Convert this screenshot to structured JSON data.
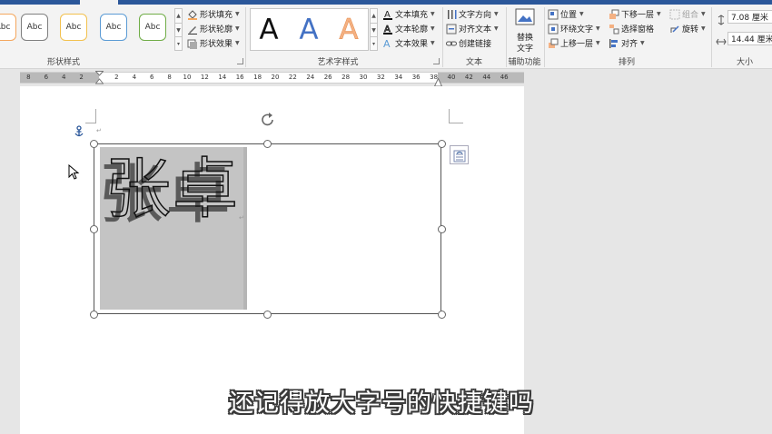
{
  "ribbon": {
    "shape_styles": {
      "label": "形状样式",
      "thumbnails": [
        {
          "text": "Abc",
          "color": "#f4a75e"
        },
        {
          "text": "Abc",
          "color": "#7f7f7f"
        },
        {
          "text": "Abc",
          "color": "#f2c14e"
        },
        {
          "text": "Abc",
          "color": "#5b9bd5"
        },
        {
          "text": "Abc",
          "color": "#70ad47"
        }
      ],
      "fill": "形状填充",
      "outline": "形状轮廓",
      "effect": "形状效果"
    },
    "wordart": {
      "label": "艺术字样式",
      "samples": [
        {
          "text": "A",
          "color": "#111111"
        },
        {
          "text": "A",
          "color": "#4472c4"
        },
        {
          "text": "A",
          "color": "#f4b183"
        }
      ],
      "text_fill": "文本填充",
      "text_outline": "文本轮廓",
      "text_effect": "文本效果"
    },
    "text_group": {
      "label": "文本",
      "direction": "文字方向",
      "align": "对齐文本",
      "link": "创建链接"
    },
    "accessibility": {
      "label": "辅助功能",
      "alt_text_line1": "替换",
      "alt_text_line2": "文字"
    },
    "arrange": {
      "label": "排列",
      "position": "位置",
      "wrap": "环绕文字",
      "forward": "上移一层",
      "backward": "下移一层",
      "selection_pane": "选择窗格",
      "align": "对齐",
      "group": "组合",
      "rotate": "旋转"
    },
    "size": {
      "label": "大小",
      "height": "7.08 厘米",
      "width": "14.44 厘米"
    }
  },
  "ruler": {
    "left_numbers": [
      "8",
      "6",
      "4",
      "2"
    ],
    "right_numbers": [
      "2",
      "4",
      "6",
      "8",
      "10",
      "12",
      "14",
      "16",
      "18",
      "20",
      "22",
      "24",
      "26",
      "28",
      "30",
      "32",
      "34",
      "36",
      "38",
      "40",
      "42",
      "44",
      "46"
    ]
  },
  "document": {
    "name_text": "张卓"
  },
  "subtitle": "还记得放大字号的快捷键吗",
  "colors": {
    "brand_blue": "#2b579a",
    "ribbon_bg": "#f3f3f3",
    "page_bg": "#ffffff",
    "text_highlight": "#c4c4c4"
  }
}
